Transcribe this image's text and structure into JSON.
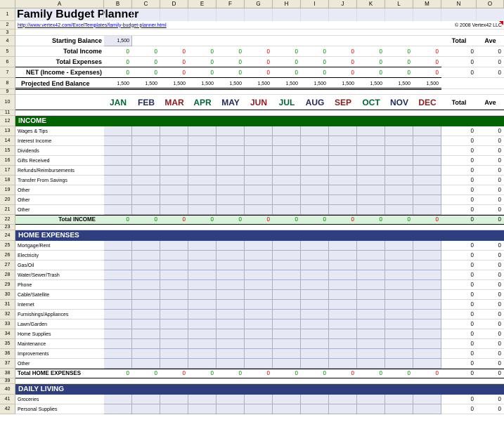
{
  "columns": [
    "A",
    "B",
    "C",
    "D",
    "E",
    "F",
    "G",
    "H",
    "I",
    "J",
    "K",
    "L",
    "M",
    "N",
    "O"
  ],
  "rows": [
    "1",
    "2",
    "3",
    "4",
    "5",
    "6",
    "7",
    "8",
    "9",
    "10",
    "11",
    "12",
    "13",
    "14",
    "15",
    "16",
    "17",
    "18",
    "19",
    "20",
    "21",
    "22",
    "23",
    "24",
    "25",
    "26",
    "27",
    "28",
    "29",
    "30",
    "31",
    "32",
    "33",
    "34",
    "35",
    "36",
    "37",
    "38",
    "39",
    "40",
    "41",
    "42"
  ],
  "title": "Family Budget Planner",
  "url": "http://www.vertex42.com/ExcelTemplates/family-budget-planner.html",
  "copyright": "© 2008 Vertex42 LLC",
  "summary": {
    "starting_balance_label": "Starting Balance",
    "starting_balance": "1,500",
    "total_income_label": "Total Income",
    "total_expenses_label": "Total Expenses",
    "net_label": "NET (Income - Expenses)",
    "projected_label": "Projected End Balance",
    "projected_value": "1,500",
    "total_label": "Total",
    "ave_label": "Ave",
    "zero": "0"
  },
  "months": [
    "JAN",
    "FEB",
    "MAR",
    "APR",
    "MAY",
    "JUN",
    "JUL",
    "AUG",
    "SEP",
    "OCT",
    "NOV",
    "DEC"
  ],
  "month_colors": [
    "#006633",
    "#1F2A5A",
    "#8B1A1A",
    "#006633",
    "#1F2A5A",
    "#8B1A1A",
    "#006633",
    "#1F2A5A",
    "#8B1A1A",
    "#006633",
    "#1F2A5A",
    "#8B1A1A"
  ],
  "header_total": "Total",
  "header_ave": "Ave",
  "colors": {
    "income_band": "#006400",
    "income_total_bg": "#D8F2DC",
    "home_band": "#2F3E7E",
    "daily_band": "#2F3E7E",
    "input_fill": "#E6E9F4",
    "green": "#008000",
    "red": "#C00000"
  },
  "income": {
    "heading": "INCOME",
    "items": [
      "Wages & Tips",
      "Interest Income",
      "Dividends",
      "Gifts Received",
      "Refunds/Reimbursements",
      "Transfer From Savings",
      "Other",
      "Other",
      "Other"
    ],
    "total_label": "Total INCOME"
  },
  "home": {
    "heading": "HOME EXPENSES",
    "items": [
      "Mortgage/Rent",
      "Electricity",
      "Gas/Oil",
      "Water/Sewer/Trash",
      "Phone",
      "Cable/Satellite",
      "Internet",
      "Furnishings/Appliances",
      "Lawn/Garden",
      "Home Supplies",
      "Maintenance",
      "Improvements",
      "Other"
    ],
    "total_label": "Total HOME EXPENSES"
  },
  "daily": {
    "heading": "DAILY LIVING",
    "items": [
      "Groceries",
      "Personal Supplies"
    ]
  }
}
